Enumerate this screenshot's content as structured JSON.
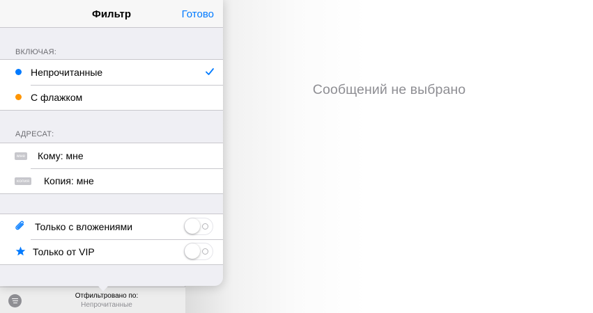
{
  "detail": {
    "empty_text": "Сообщений не выбрано"
  },
  "toolbar": {
    "filtered_by": "Отфильтровано по:",
    "filter_value": "Непрочитанные",
    "filter_icon": "filter-icon"
  },
  "popover": {
    "title": "Фильтр",
    "done_label": "Готово",
    "accent_color": "#007aff",
    "sections": {
      "including": {
        "header": "ВКЛЮЧАЯ:",
        "items": [
          {
            "label": "Непрочитанные",
            "dot_color": "#007aff",
            "selected": true
          },
          {
            "label": "С флажком",
            "dot_color": "#ff9500",
            "selected": false
          }
        ]
      },
      "addressee": {
        "header": "АДРЕСАТ:",
        "items": [
          {
            "tag": "мне",
            "label": "Кому: мне",
            "selected": false
          },
          {
            "tag": "копия",
            "label": "Копия: мне",
            "selected": false
          }
        ]
      },
      "options": {
        "items": [
          {
            "icon": "paperclip-icon",
            "label": "Только с вложениями",
            "on": false
          },
          {
            "icon": "star-icon",
            "label": "Только от VIP",
            "on": false
          }
        ]
      }
    }
  }
}
